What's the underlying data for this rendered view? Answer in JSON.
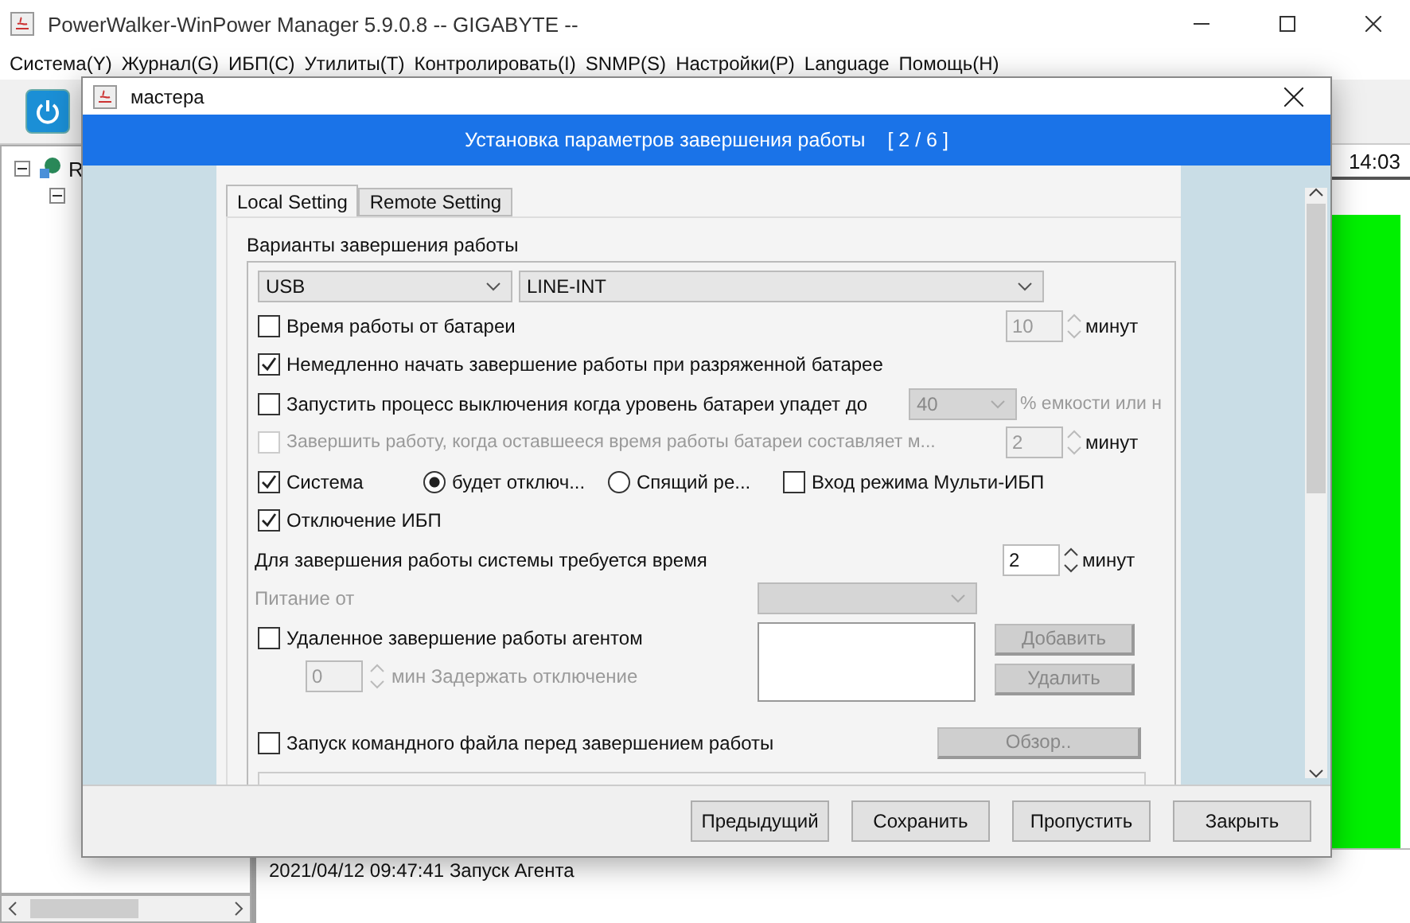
{
  "main_window": {
    "title": "PowerWalker-WinPower Manager 5.9.0.8 -- GIGABYTE --",
    "menu": [
      "Система(Y)",
      "Журнал(G)",
      "ИБП(C)",
      "Утилиты(T)",
      "Контролировать(I)",
      "SNMP(S)",
      "Настройки(P)",
      "Language",
      "Помощь(H)"
    ],
    "tree_root": "R",
    "time": "14:03",
    "log": [
      "2021/04/12 09:47:41  Запуск Агента"
    ]
  },
  "dialog": {
    "title": "мастера",
    "header": "Установка параметров завершения работы",
    "step": "[ 2 / 6 ]",
    "tabs": [
      {
        "label": "Local Setting",
        "selected": true
      },
      {
        "label": "Remote Setting",
        "selected": false
      }
    ],
    "group_label": "Варианты завершения работы",
    "port": "USB",
    "ups_type": "LINE-INT",
    "battery_time": {
      "label": "Время работы от батареи",
      "checked": false,
      "value": "10",
      "unit": "минут",
      "disabled": true
    },
    "low_battery": {
      "label": "Немедленно начать завершение работы при разряженной батарее",
      "checked": true
    },
    "battery_level": {
      "label": "Запустить процесс выключения когда уровень батареи упадет до",
      "checked": false,
      "value": "40",
      "unit": "% емкости или н",
      "disabled": true
    },
    "remaining_time": {
      "label": "Завершить работу, когда оставшееся время работы батареи составляет м...",
      "checked": false,
      "value": "2",
      "unit": "минут",
      "disabled": true
    },
    "system": {
      "label": "Система",
      "checked": true,
      "modes": [
        {
          "label": "будет отключ...",
          "selected": true
        },
        {
          "label": "Спящий ре...",
          "selected": false
        }
      ],
      "multi_ups": {
        "label": "Вход режима Мульти-ИБП",
        "checked": false
      }
    },
    "ups_off": {
      "label": "Отключение ИБП",
      "checked": true
    },
    "shutdown_time": {
      "label": "Для завершения работы системы требуется время",
      "value": "2",
      "unit": "минут"
    },
    "power_from": {
      "label": "Питание от",
      "disabled": true
    },
    "remote_agent": {
      "label": "Удаленное завершение работы агентом",
      "checked": false,
      "delay_value": "0",
      "delay_label": "мин Задержать отключение",
      "add": "Добавить",
      "remove": "Удалить"
    },
    "command_file": {
      "label": "Запуск командного файла перед завершением работы",
      "checked": false,
      "browse": "Обзор.."
    },
    "buttons": [
      "Предыдущий",
      "Сохранить",
      "Пропустить",
      "Закрыть"
    ]
  }
}
